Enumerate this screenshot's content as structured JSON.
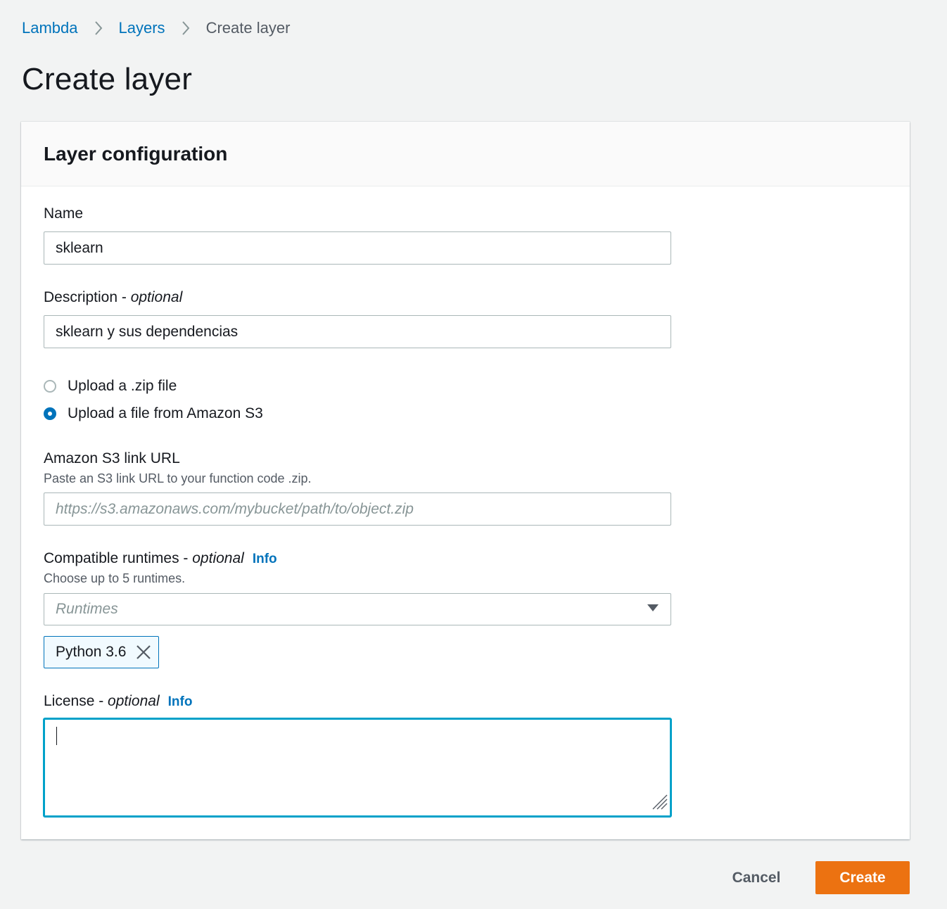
{
  "breadcrumb": {
    "items": [
      {
        "label": "Lambda"
      },
      {
        "label": "Layers"
      },
      {
        "label": "Create layer"
      }
    ]
  },
  "page": {
    "title": "Create layer"
  },
  "panel": {
    "title": "Layer configuration",
    "name": {
      "label": "Name",
      "value": "sklearn"
    },
    "description": {
      "label": "Description - ",
      "optional": "optional",
      "value": "sklearn y sus dependencias"
    },
    "upload_options": [
      {
        "label": "Upload a .zip file",
        "selected": false
      },
      {
        "label": "Upload a file from Amazon S3",
        "selected": true
      }
    ],
    "s3_url": {
      "label": "Amazon S3 link URL",
      "hint": "Paste an S3 link URL to your function code .zip.",
      "value": "",
      "placeholder": "https://s3.amazonaws.com/mybucket/path/to/object.zip"
    },
    "runtimes": {
      "label": "Compatible runtimes - ",
      "optional": "optional",
      "info": "Info",
      "hint": "Choose up to 5 runtimes.",
      "placeholder": "Runtimes",
      "selected_tokens": [
        "Python 3.6"
      ]
    },
    "license": {
      "label": "License - ",
      "optional": "optional",
      "info": "Info",
      "value": ""
    }
  },
  "actions": {
    "cancel": "Cancel",
    "create": "Create"
  },
  "colors": {
    "link": "#0073bb",
    "primary_button": "#ec7211",
    "focus_border": "#00a1c9",
    "background": "#f2f3f3"
  },
  "icons": {
    "breadcrumb_separator": "chevron-right-icon",
    "select_caret": "caret-down-icon",
    "token_remove": "close-icon",
    "textarea_resize": "resize-grip-icon"
  }
}
